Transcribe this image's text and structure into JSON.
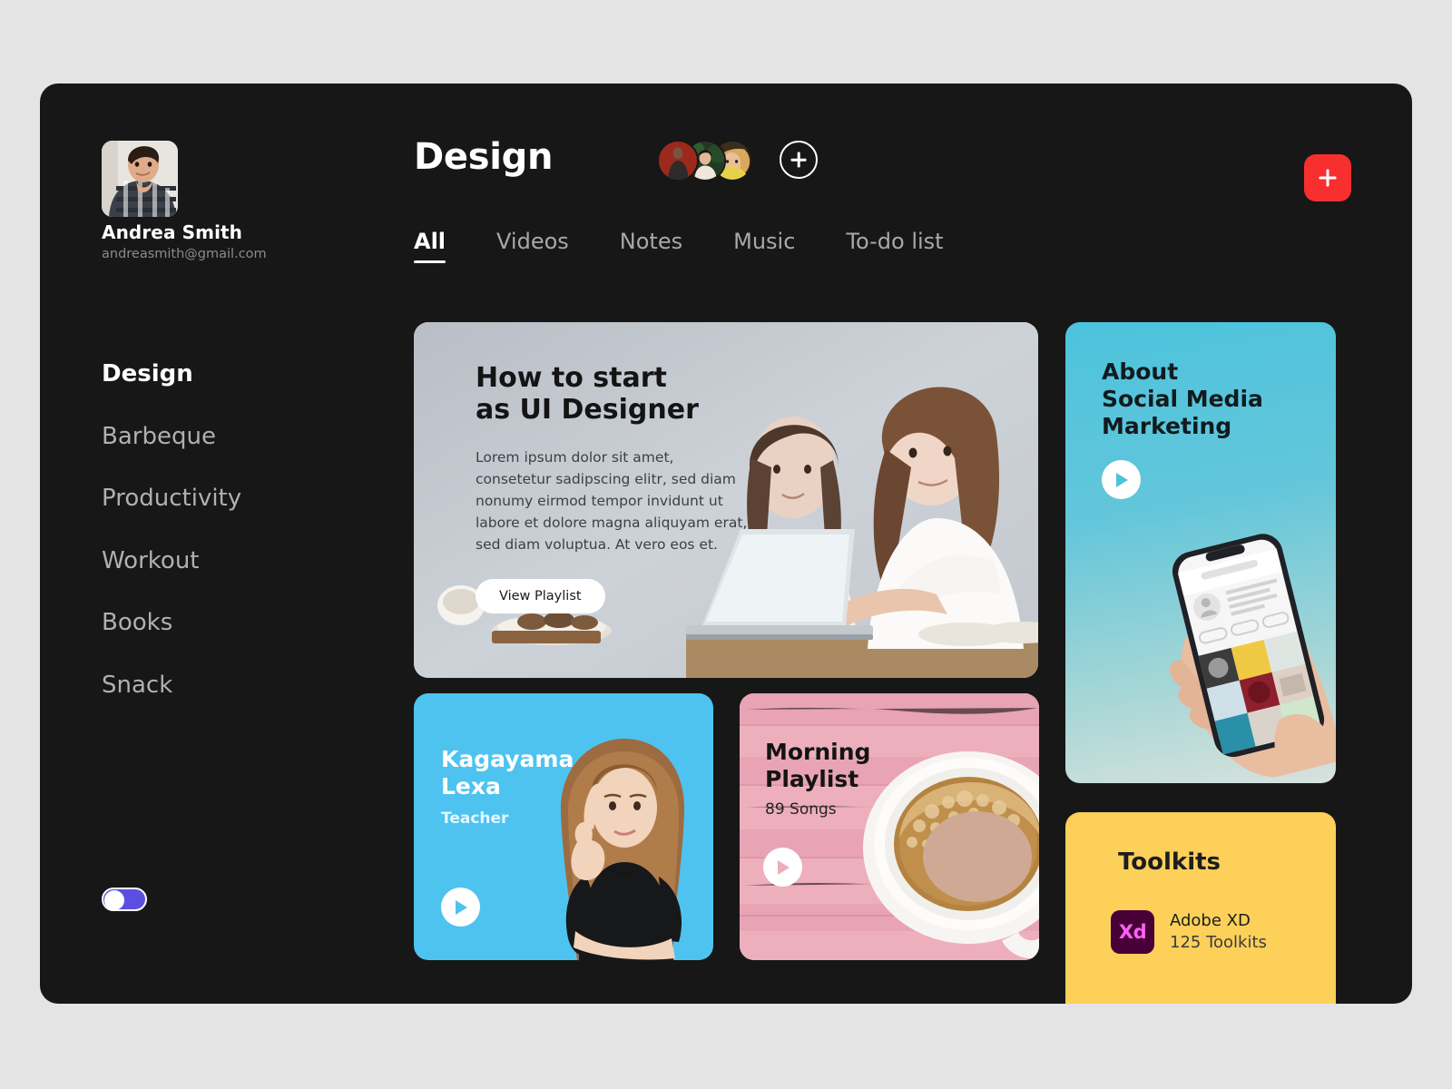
{
  "colors": {
    "page_background": "#e4e4e4",
    "panel_background": "#171717",
    "accent_red": "#f72f2f",
    "accent_blue": "#4ec3f0",
    "accent_pink": "#edaebc",
    "accent_yellow": "#fcd059",
    "accent_teal": "#4cc3dd",
    "toggle_purple": "#5b4fe0",
    "xd_purple": "#470137",
    "xd_pink": "#ff61f6"
  },
  "profile": {
    "name": "Andrea Smith",
    "email": "andreasmith@gmail.com",
    "avatar_icon": "user-photo-avatar"
  },
  "sidebar": {
    "items": [
      {
        "label": "Design",
        "active": true
      },
      {
        "label": "Barbeque",
        "active": false
      },
      {
        "label": "Productivity",
        "active": false
      },
      {
        "label": "Workout",
        "active": false
      },
      {
        "label": "Books",
        "active": false
      },
      {
        "label": "Snack",
        "active": false
      }
    ],
    "theme_toggle": {
      "state": "off",
      "knob_position": "left"
    }
  },
  "header": {
    "title": "Design",
    "members": [
      {
        "icon": "member-avatar-1"
      },
      {
        "icon": "member-avatar-2"
      },
      {
        "icon": "member-avatar-3"
      }
    ],
    "add_member_icon": "plus-circle-icon",
    "add_content_icon": "plus-icon"
  },
  "tabs": [
    {
      "label": "All",
      "active": true
    },
    {
      "label": "Videos",
      "active": false
    },
    {
      "label": "Notes",
      "active": false
    },
    {
      "label": "Music",
      "active": false
    },
    {
      "label": "To-do list",
      "active": false
    }
  ],
  "cards": {
    "hero": {
      "title": "How to start\nas UI Designer",
      "description": "Lorem ipsum dolor sit amet, consetetur sadipscing elitr, sed diam nonumy eirmod tempor invidunt ut labore et dolore magna aliquyam erat, sed diam voluptua. At vero eos et.",
      "button_label": "View Playlist",
      "image_icon": "two-women-at-laptop-photo"
    },
    "about": {
      "title": "About\nSocial Media\nMarketing",
      "play_icon": "play-icon",
      "image_icon": "hand-holding-phone-photo"
    },
    "teacher": {
      "name": "Kagayama\nLexa",
      "role": "Teacher",
      "play_icon": "play-icon",
      "image_icon": "woman-pointing-photo"
    },
    "playlist": {
      "title": "Morning\nPlaylist",
      "count": "89 Songs",
      "play_icon": "play-icon",
      "image_icon": "coffee-cup-on-pink-wood-photo"
    },
    "toolkits": {
      "title": "Toolkits",
      "items": [
        {
          "icon_label": "Xd",
          "name": "Adobe XD",
          "count": "125 Toolkits"
        }
      ]
    }
  }
}
